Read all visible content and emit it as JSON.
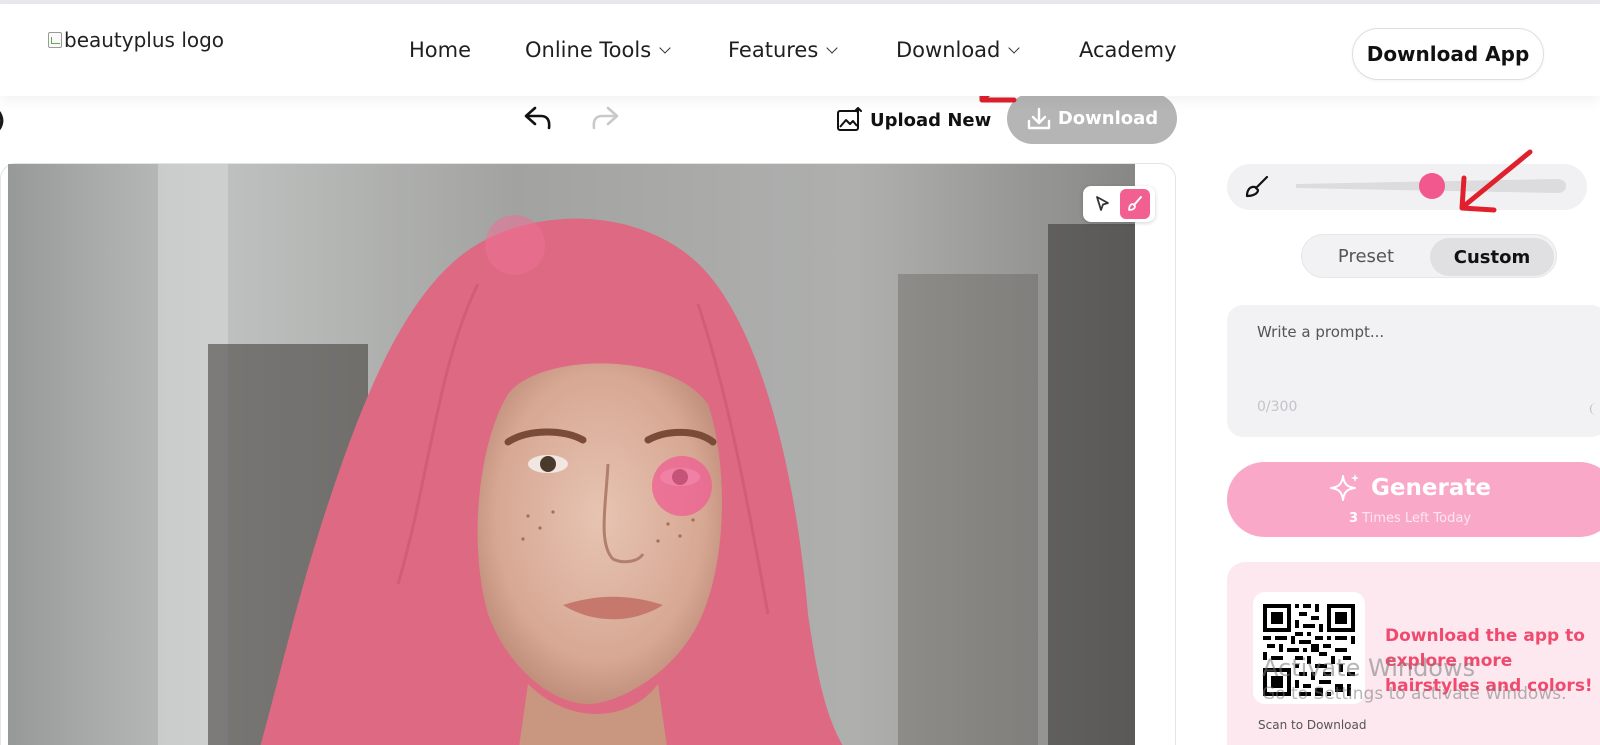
{
  "header": {
    "logo_alt": "beautyplus logo",
    "nav": [
      {
        "label": "Home",
        "has_dropdown": false
      },
      {
        "label": "Online Tools",
        "has_dropdown": true
      },
      {
        "label": "Features",
        "has_dropdown": true
      },
      {
        "label": "Download",
        "has_dropdown": true
      },
      {
        "label": "Academy",
        "has_dropdown": false
      }
    ],
    "cta_label": "Download App"
  },
  "toolbar": {
    "left_edge_text": ")",
    "undo_icon": "undo-icon",
    "redo_icon": "redo-icon",
    "upload_label": "Upload New",
    "download_label": "Download"
  },
  "canvas": {
    "mode_tools": [
      "pointer-icon",
      "brush-icon"
    ],
    "active_tool": "brush",
    "mask_color": "#f25f91"
  },
  "panel": {
    "brush_size_fraction": 0.55,
    "segments": [
      "Preset",
      "Custom"
    ],
    "active_segment": "Custom",
    "prompt_placeholder": "Write a prompt...",
    "prompt_counter": "0/300",
    "generate_label": "Generate",
    "times_left_count": "3",
    "times_left_text": "Times Left Today",
    "promo_text": "Download the app to explore more hairstyles and colors!",
    "scan_label": "Scan to Download"
  },
  "system_overlay": {
    "line1": "Activate Windows",
    "line2": "Go to Settings to activate Windows."
  },
  "colors": {
    "accent_pink": "#f2578d",
    "generate_bg": "#f9a9c7",
    "promo_text": "#f04a6e",
    "annotation_red": "#e0202c"
  }
}
